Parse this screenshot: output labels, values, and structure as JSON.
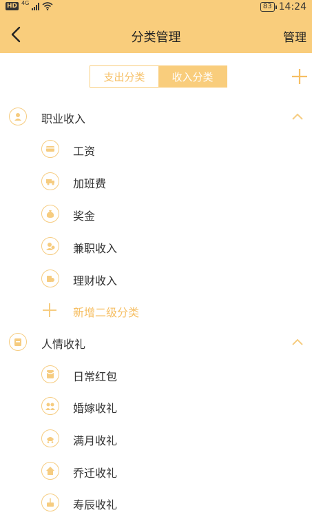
{
  "status": {
    "hd": "HD",
    "net": "4G",
    "battery": "83",
    "time": "14:24"
  },
  "header": {
    "title": "分类管理",
    "manage": "管理"
  },
  "tabs": [
    {
      "label": "支出分类"
    },
    {
      "label": "收入分类"
    }
  ],
  "categories": [
    {
      "label": "职业收入",
      "icon": "person-icon",
      "children": [
        {
          "label": "工资",
          "icon": "card-icon"
        },
        {
          "label": "加班费",
          "icon": "truck-icon"
        },
        {
          "label": "奖金",
          "icon": "moneybag-icon"
        },
        {
          "label": "兼职收入",
          "icon": "person-coin-icon"
        },
        {
          "label": "理财收入",
          "icon": "finance-icon"
        }
      ],
      "add_sub_label": "新增二级分类"
    },
    {
      "label": "人情收礼",
      "icon": "gift-icon",
      "children": [
        {
          "label": "日常红包",
          "icon": "red-envelope-icon"
        },
        {
          "label": "婚嫁收礼",
          "icon": "couple-icon"
        },
        {
          "label": "满月收礼",
          "icon": "baby-icon"
        },
        {
          "label": "乔迁收礼",
          "icon": "house-icon"
        },
        {
          "label": "寿辰收礼",
          "icon": "cake-icon"
        }
      ]
    }
  ],
  "colors": {
    "accent": "#f9cd7c",
    "accent_text": "#f6bf64"
  }
}
